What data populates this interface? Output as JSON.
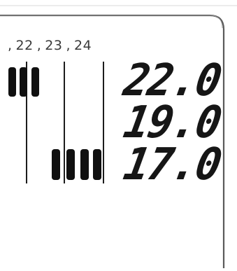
{
  "display": {
    "hour_labels": [
      "22",
      "23",
      "24"
    ],
    "hour_separator": ",",
    "readings": [
      "22.0",
      "19.0",
      "17.0"
    ]
  }
}
